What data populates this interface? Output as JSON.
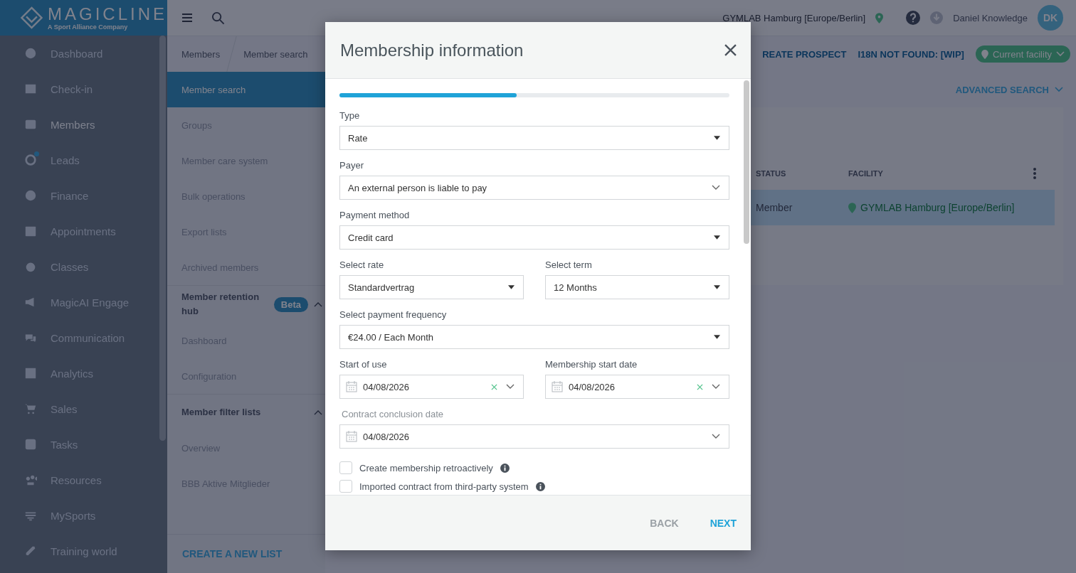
{
  "logo": {
    "name": "MAGICLINE",
    "tagline": "A Sport Alliance Company"
  },
  "sidebar": {
    "items": [
      {
        "label": "Dashboard",
        "selected": false,
        "badge": false
      },
      {
        "label": "Check-in",
        "selected": false,
        "badge": false
      },
      {
        "label": "Members",
        "selected": true,
        "badge": false
      },
      {
        "label": "Leads",
        "selected": false,
        "badge": true
      },
      {
        "label": "Finance",
        "selected": false,
        "badge": false
      },
      {
        "label": "Appointments",
        "selected": false,
        "badge": false
      },
      {
        "label": "Classes",
        "selected": false,
        "badge": false
      },
      {
        "label": "MagicAI Engage",
        "selected": false,
        "badge": false
      },
      {
        "label": "Communication",
        "selected": false,
        "badge": false
      },
      {
        "label": "Analytics",
        "selected": false,
        "badge": false
      },
      {
        "label": "Sales",
        "selected": false,
        "badge": false
      },
      {
        "label": "Tasks",
        "selected": false,
        "badge": false
      },
      {
        "label": "Resources",
        "selected": false,
        "badge": false
      },
      {
        "label": "MySports",
        "selected": false,
        "badge": false
      },
      {
        "label": "Training world",
        "selected": false,
        "badge": false
      }
    ]
  },
  "topbar": {
    "facility": "GYMLAB Hamburg [Europe/Berlin]",
    "user": "Daniel Knowledge",
    "initials": "DK"
  },
  "breadcrumbs": [
    "Members",
    "Member search"
  ],
  "actions": [
    "REATE PROSPECT",
    "I18N NOT FOUND: [WIP]"
  ],
  "facility_filter": "Current facility",
  "subnav": {
    "items": [
      {
        "label": "Member search",
        "selected": true
      },
      {
        "label": "Groups",
        "selected": false
      },
      {
        "label": "Member care system",
        "selected": false
      },
      {
        "label": "Bulk operations",
        "selected": false
      },
      {
        "label": "Export lists",
        "selected": false
      },
      {
        "label": "Archived members",
        "selected": false
      }
    ],
    "sections": [
      {
        "title": "Member retention hub",
        "badge": "Beta",
        "expanded": true,
        "items": [
          {
            "label": "Dashboard",
            "selected": false
          },
          {
            "label": "Configuration",
            "selected": false
          }
        ]
      },
      {
        "title": "Member filter lists",
        "expanded": true,
        "items": [
          {
            "label": "Overview",
            "selected": false
          },
          {
            "label": "BBB Aktive Mitglieder",
            "selected": false
          }
        ]
      }
    ],
    "footer_link": "CREATE A NEW LIST"
  },
  "advanced_search": "ADVANCED SEARCH",
  "table": {
    "columns": [
      "STATUS",
      "FACILITY"
    ],
    "rows": [
      {
        "status": "Member",
        "facility": "GYMLAB Hamburg [Europe/Berlin]",
        "selected": true
      }
    ]
  },
  "modal": {
    "title": "Membership information",
    "progress": {
      "level": 0.455
    },
    "rows": [
      [
        {
          "label": "Type",
          "value": "Rate",
          "kind": "select"
        }
      ],
      [
        {
          "label": "Payer",
          "value": "An external person is liable to pay",
          "kind": "dropdown"
        }
      ],
      [
        {
          "label": "Payment method",
          "value": "Credit card",
          "kind": "select"
        }
      ],
      [
        {
          "label": "Select rate",
          "value": "Standardvertrag",
          "kind": "select"
        },
        {
          "label": "Select term",
          "value": "12 Months",
          "kind": "select"
        }
      ],
      [
        {
          "label": "Select payment frequency",
          "value": "€24.00 / Each Month",
          "kind": "select"
        }
      ],
      [
        {
          "label": "Start of use",
          "value": "04/08/2026",
          "kind": "date",
          "clearable": true
        },
        {
          "label": "Membership start date",
          "value": "04/08/2026",
          "kind": "date",
          "clearable": true
        }
      ],
      [
        {
          "label": "Contract conclusion date",
          "value": "04/08/2026",
          "kind": "date",
          "clearable": false
        }
      ]
    ],
    "checkboxes": [
      {
        "label": "Create membership retroactively",
        "checked": false
      },
      {
        "label": "Imported contract from third-party system",
        "checked": false
      }
    ],
    "buttons": [
      {
        "label": "BACK",
        "kind": "secondary"
      },
      {
        "label": "NEXT",
        "kind": "primary"
      }
    ]
  }
}
